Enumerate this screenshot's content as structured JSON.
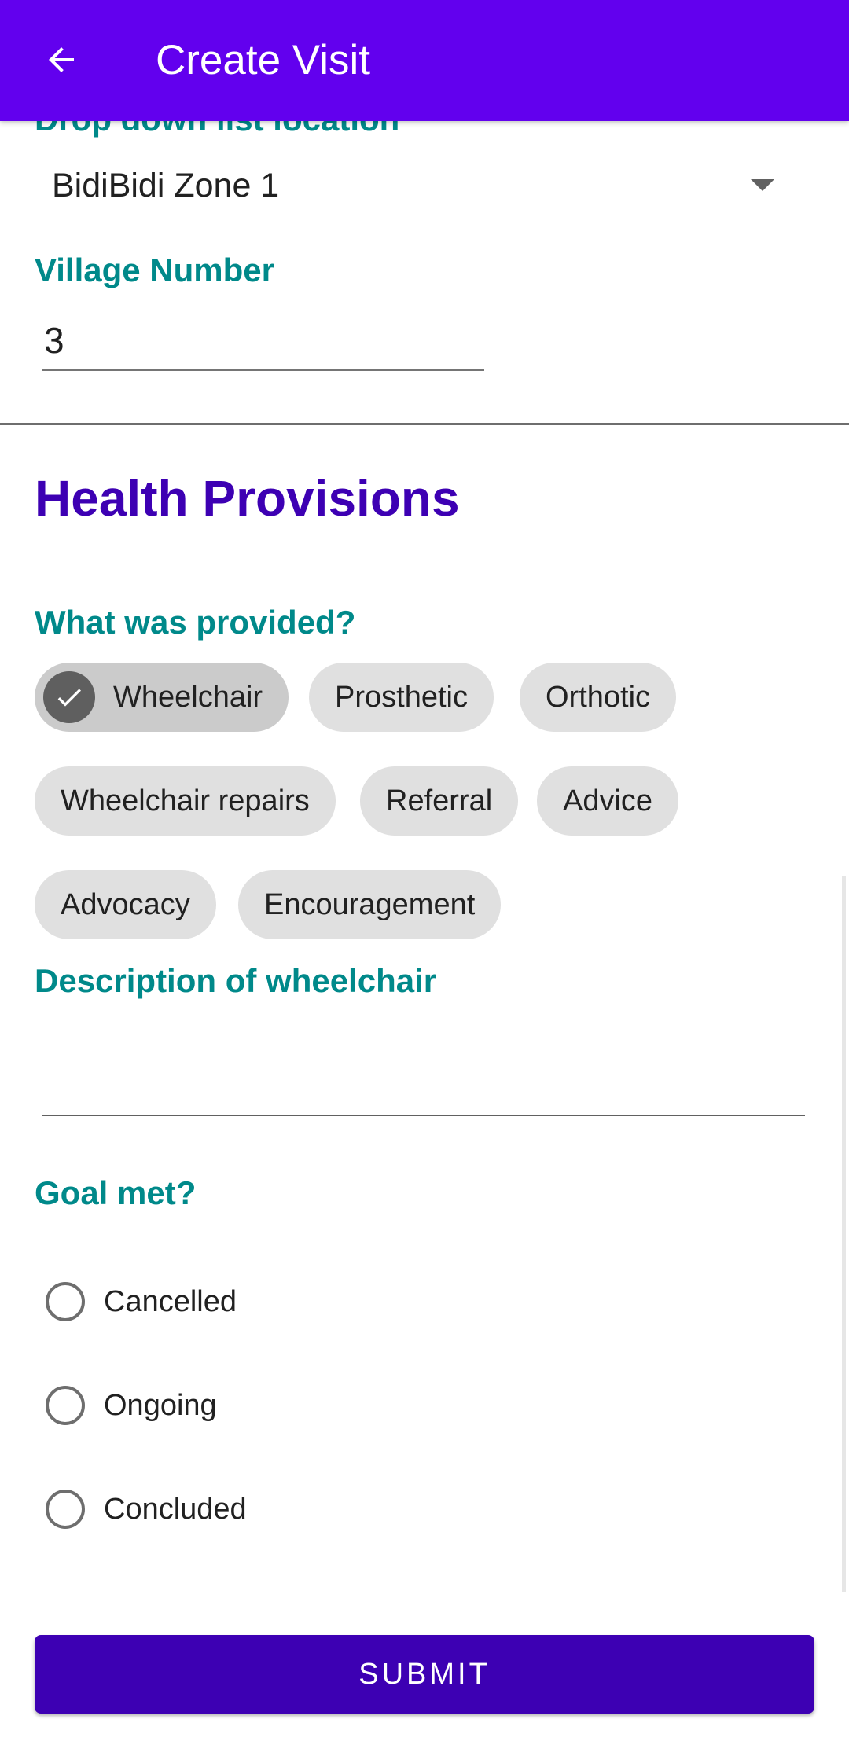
{
  "app_bar": {
    "title": "Create Visit",
    "back_icon": "arrow-back-icon",
    "background_color": "#6200ee"
  },
  "location": {
    "label": "Drop down list location",
    "selected_value": "BidiBidi Zone 1",
    "arrow_icon": "dropdown-arrow-icon"
  },
  "village": {
    "label": "Village Number",
    "value": "3"
  },
  "health_provisions": {
    "title": "Health Provisions",
    "question": "What was provided?",
    "chips": [
      {
        "label": "Wheelchair",
        "selected": true
      },
      {
        "label": "Prosthetic",
        "selected": false
      },
      {
        "label": "Orthotic",
        "selected": false
      },
      {
        "label": "Wheelchair repairs",
        "selected": false
      },
      {
        "label": "Referral",
        "selected": false
      },
      {
        "label": "Advice",
        "selected": false
      },
      {
        "label": "Advocacy",
        "selected": false
      },
      {
        "label": "Encouragement",
        "selected": false
      }
    ],
    "check_icon": "check-icon",
    "description_label": "Description of wheelchair",
    "description_value": ""
  },
  "goal": {
    "label": "Goal met?",
    "options": [
      {
        "label": "Cancelled",
        "selected": false
      },
      {
        "label": "Ongoing",
        "selected": false
      },
      {
        "label": "Concluded",
        "selected": false
      }
    ]
  },
  "submit": {
    "label": "SUBMIT"
  },
  "colors": {
    "accent_teal": "#00898a",
    "section_title": "#3d00b3",
    "submit_button": "#3d00b3"
  }
}
